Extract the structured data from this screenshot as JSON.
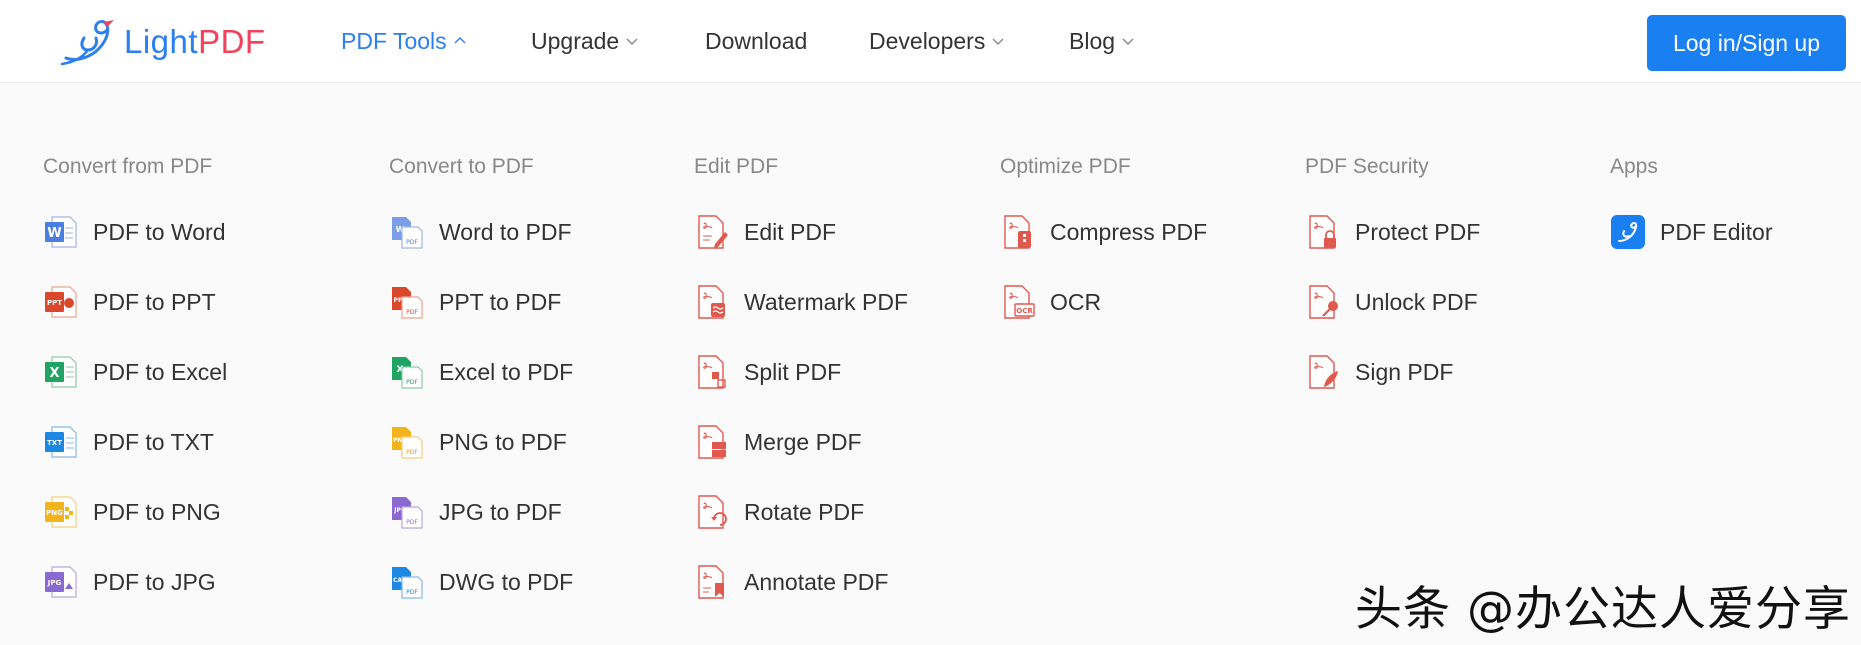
{
  "brand": {
    "logo_light": "Light",
    "logo_pdf": "PDF",
    "colors": {
      "blue": "#2b7ff0",
      "red": "#f2425b",
      "button": "#1a7ff0"
    }
  },
  "nav": {
    "pdf_tools": "PDF Tools",
    "upgrade": "Upgrade",
    "download": "Download",
    "developers": "Developers",
    "blog": "Blog",
    "login": "Log in/Sign up"
  },
  "menu": {
    "convert_from": {
      "title": "Convert from PDF",
      "items": [
        {
          "label": "PDF to Word",
          "icon": "word-doc-icon"
        },
        {
          "label": "PDF to PPT",
          "icon": "ppt-doc-icon"
        },
        {
          "label": "PDF to Excel",
          "icon": "excel-doc-icon"
        },
        {
          "label": "PDF to TXT",
          "icon": "txt-doc-icon"
        },
        {
          "label": "PDF to PNG",
          "icon": "png-doc-icon"
        },
        {
          "label": "PDF to JPG",
          "icon": "jpg-doc-icon"
        }
      ]
    },
    "convert_to": {
      "title": "Convert to PDF",
      "items": [
        {
          "label": "Word to PDF",
          "icon": "word-to-pdf-icon"
        },
        {
          "label": "PPT to PDF",
          "icon": "ppt-to-pdf-icon"
        },
        {
          "label": "Excel to PDF",
          "icon": "excel-to-pdf-icon"
        },
        {
          "label": "PNG to PDF",
          "icon": "png-to-pdf-icon"
        },
        {
          "label": "JPG to PDF",
          "icon": "jpg-to-pdf-icon"
        },
        {
          "label": "DWG to PDF",
          "icon": "dwg-to-pdf-icon"
        }
      ]
    },
    "edit": {
      "title": "Edit PDF",
      "items": [
        {
          "label": "Edit PDF",
          "icon": "edit-pdf-icon"
        },
        {
          "label": "Watermark PDF",
          "icon": "watermark-pdf-icon"
        },
        {
          "label": "Split PDF",
          "icon": "split-pdf-icon"
        },
        {
          "label": "Merge PDF",
          "icon": "merge-pdf-icon"
        },
        {
          "label": "Rotate PDF",
          "icon": "rotate-pdf-icon"
        },
        {
          "label": "Annotate PDF",
          "icon": "annotate-pdf-icon"
        }
      ]
    },
    "optimize": {
      "title": "Optimize PDF",
      "items": [
        {
          "label": "Compress PDF",
          "icon": "compress-pdf-icon"
        },
        {
          "label": "OCR",
          "icon": "ocr-pdf-icon"
        }
      ]
    },
    "security": {
      "title": "PDF Security",
      "items": [
        {
          "label": "Protect PDF",
          "icon": "protect-pdf-icon"
        },
        {
          "label": "Unlock PDF",
          "icon": "unlock-pdf-icon"
        },
        {
          "label": "Sign PDF",
          "icon": "sign-pdf-icon"
        }
      ]
    },
    "apps": {
      "title": "Apps",
      "items": [
        {
          "label": "PDF Editor",
          "icon": "pdf-editor-app-icon"
        }
      ]
    }
  },
  "watermark": "头条 @办公达人爱分享"
}
